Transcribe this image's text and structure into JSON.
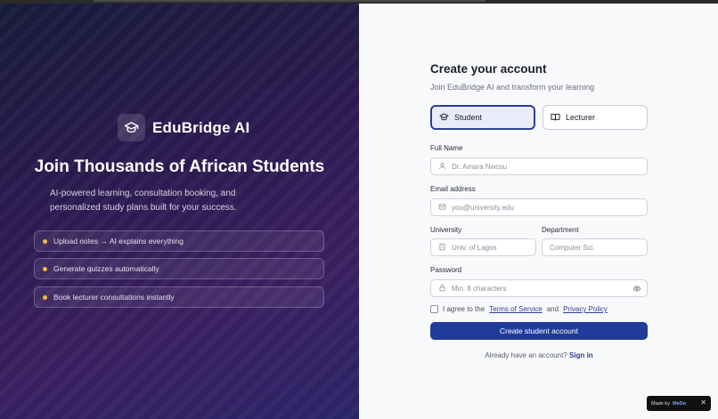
{
  "brand": {
    "name": "EduBridge AI",
    "icon": "graduation-cap-icon"
  },
  "hero": {
    "title": "Join Thousands of African Students",
    "subtitle": "AI-powered learning, consultation booking, and personalized study plans built for your success."
  },
  "features": [
    "Upload notes → AI explains everything",
    "Generate quizzes automatically",
    "Book lecturer consultations instantly"
  ],
  "form": {
    "title": "Create your account",
    "subtitle": "Join EduBridge AI and transform your learning",
    "roles": {
      "student": "Student",
      "lecturer": "Lecturer"
    },
    "full_name": {
      "label": "Full Name",
      "placeholder": "Dr. Amara Nwosu"
    },
    "email": {
      "label": "Email address",
      "placeholder": "you@university.edu"
    },
    "university": {
      "label": "University",
      "placeholder": "Univ. of Lagos"
    },
    "department": {
      "label": "Department",
      "placeholder": "Computer Sci."
    },
    "password": {
      "label": "Password",
      "placeholder": "Min. 8 characters"
    },
    "terms": {
      "prefix": "I agree to the",
      "tos": "Terms of Service",
      "and": "and",
      "privacy": "Privacy Policy"
    },
    "submit": "Create student account",
    "signin_prompt": "Already have an account?",
    "signin_link": "Sign in"
  },
  "badge": {
    "prefix": "Made by",
    "brand": "MeDo",
    "close": "✕"
  },
  "colors": {
    "accent": "#1f3c9b",
    "bullet": "#f2b84b"
  }
}
